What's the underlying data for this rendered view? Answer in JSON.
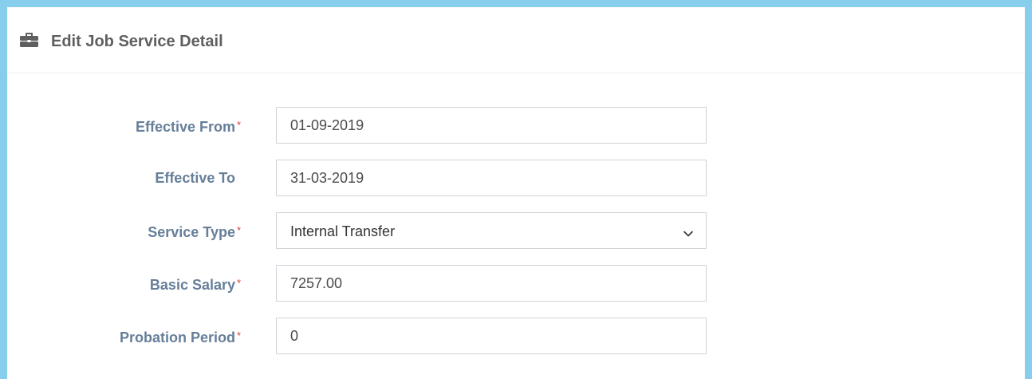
{
  "panel": {
    "title": "Edit Job Service Detail",
    "icon": "briefcase-icon"
  },
  "form": {
    "required_marker": "*",
    "effective_from": {
      "label": "Effective From",
      "value": "01-09-2019",
      "required": true
    },
    "effective_to": {
      "label": "Effective To",
      "value": "31-03-2019",
      "required": false
    },
    "service_type": {
      "label": "Service Type",
      "value": "Internal Transfer",
      "required": true
    },
    "basic_salary": {
      "label": "Basic Salary",
      "value": "7257.00",
      "required": true
    },
    "probation_period": {
      "label": "Probation Period",
      "value": "0",
      "required": true
    }
  },
  "colors": {
    "frame_border": "#87ceec",
    "label": "#667f99",
    "required": "#d43f3a",
    "title": "#5f5f5f"
  }
}
